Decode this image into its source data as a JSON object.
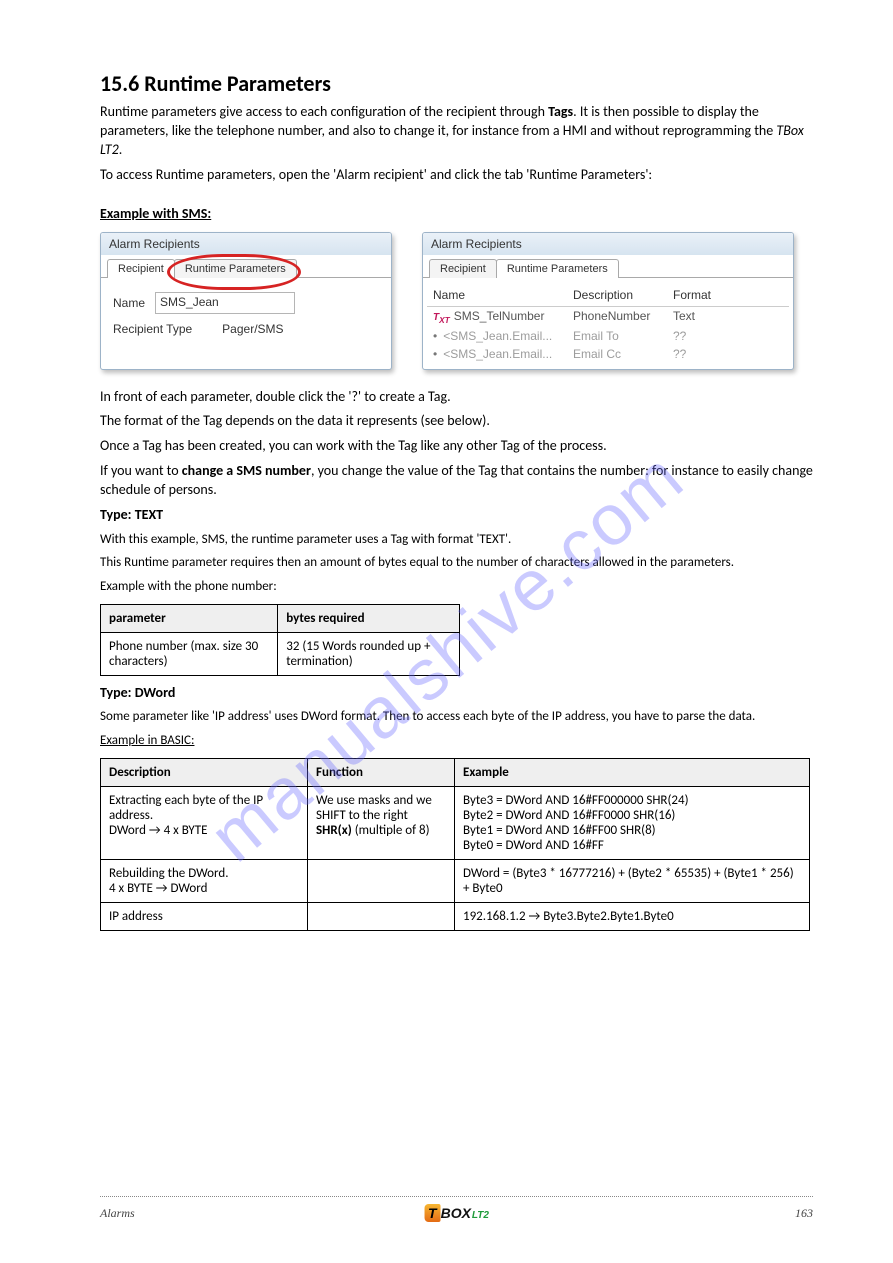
{
  "heading": "15.6 Runtime Parameters",
  "intro1_prefix": "Runtime parameters give access to each configuration of the recipient through ",
  "intro1_bold": "Tags",
  "intro1_suffix": ". It is then possible to display the parameters, like the telephone number, and also to change it, for instance from a HMI and without reprogramming the ",
  "intro1_italic": "TBox LT2",
  "intro1_end": ".",
  "intro2": "To access Runtime parameters, open the 'Alarm recipient' and click the tab 'Runtime Parameters':",
  "example_label": "Example with SMS:",
  "dlg_left": {
    "title": "Alarm Recipients",
    "tab1": "Recipient",
    "tab2": "Runtime Parameters",
    "name_label": "Name",
    "name_value": "SMS_Jean",
    "rtype_label": "Recipient Type",
    "rtype_value": "Pager/SMS"
  },
  "dlg_right": {
    "title": "Alarm Recipients",
    "tab1": "Recipient",
    "tab2": "Runtime Parameters",
    "col_name": "Name",
    "col_desc": "Description",
    "col_fmt": "Format",
    "rows": [
      {
        "name": "SMS_TelNumber",
        "desc": "PhoneNumber",
        "fmt": "Text",
        "ghost": false
      },
      {
        "name": "<SMS_Jean.Email...",
        "desc": "Email To",
        "fmt": "??",
        "ghost": true
      },
      {
        "name": "<SMS_Jean.Email...",
        "desc": "Email Cc",
        "fmt": "??",
        "ghost": true
      }
    ]
  },
  "after_img1": "In front of each parameter, double click the '?' to create a Tag.",
  "after_img2": "The format of the Tag depends on the data it represents (see below).",
  "after_img3": "Once a Tag has been created, you can work with the Tag like any other Tag of the process.",
  "change_number_lead": "If you want to ",
  "change_number_bold": "change a SMS number",
  "change_number_after": ", you change the value of the Tag that contains the number: for instance to easily change schedule of persons.",
  "type_text_h": "Type: TEXT",
  "type_text_line1": "With this example, SMS, the runtime parameter uses a Tag with format 'TEXT'.",
  "type_text_line2": "This Runtime parameter requires then an amount of bytes equal to the number of characters allowed in the parameters.",
  "type_text_line3": "Example with the phone number:",
  "type_text_table": {
    "h1": "parameter",
    "h2": "bytes required",
    "r1c1": "Phone number (max. size 30 characters)",
    "r1c2": "32 (15 Words rounded up + termination)"
  },
  "type_dword_h": "Type: DWord",
  "type_dword_line": "Some parameter like 'IP address' uses DWord format. Then to access each byte of the IP address, you have to parse the data.",
  "type_dword_example": "Example in BASIC:",
  "type_dword_table": {
    "h1": "Description",
    "h2": "Function",
    "h3": "Example",
    "r1d": "Extracting each byte of the IP address.\nDWord → 4 x BYTE",
    "r1f_pre": "We use masks and we SHIFT to the right ",
    "r1f_bold": "SHR(x)",
    "r1f_post": " (multiple of 8)",
    "r1e": "Byte3 = DWord AND 16#FF000000 SHR(24)\nByte2 = DWord AND 16#FF0000 SHR(16)\nByte1 = DWord AND 16#FF00 SHR(8)\nByte0 = DWord AND 16#FF",
    "r2d": "Rebuilding the DWord.\n4 x BYTE → DWord",
    "r2f": "",
    "r2e": "DWord = (Byte3 * 16777216) + (Byte2 * 65535) + (Byte1 * 256) + Byte0",
    "r3d": "IP address",
    "r3f": "",
    "r3e": "192.168.1.2 → Byte3.Byte2.Byte1.Byte0"
  },
  "watermark": "manualshive.com",
  "footer_left": "Alarms",
  "footer_logo": {
    "t": "T",
    "box": "BOX",
    "lt2": "LT2"
  },
  "footer_right": "163"
}
